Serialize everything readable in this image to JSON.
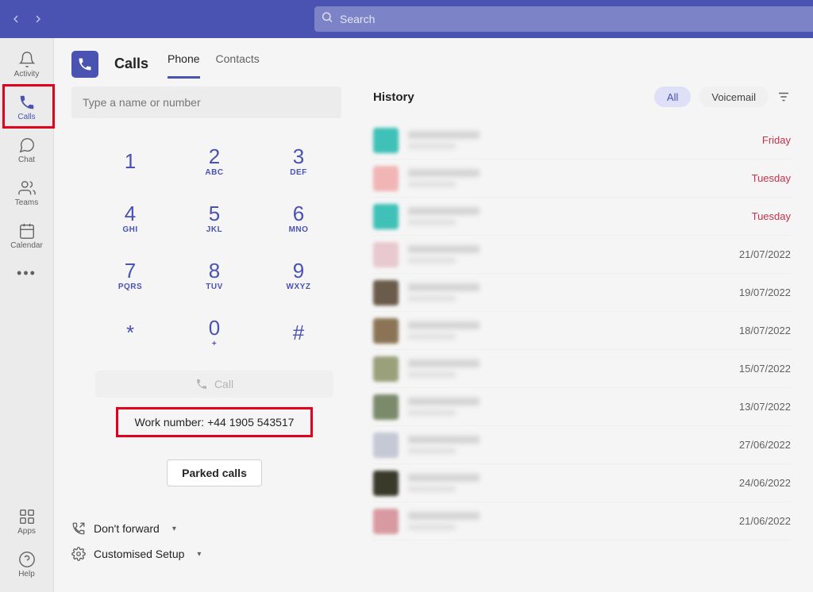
{
  "topbar": {
    "search_placeholder": "Search"
  },
  "rail": {
    "items": [
      {
        "label": "Activity"
      },
      {
        "label": "Calls"
      },
      {
        "label": "Chat"
      },
      {
        "label": "Teams"
      },
      {
        "label": "Calendar"
      }
    ],
    "bottom": [
      {
        "label": "Apps"
      },
      {
        "label": "Help"
      }
    ]
  },
  "header": {
    "title": "Calls",
    "tabs": [
      {
        "label": "Phone",
        "active": true
      },
      {
        "label": "Contacts",
        "active": false
      }
    ]
  },
  "dialer": {
    "input_placeholder": "Type a name or number",
    "keys": [
      {
        "digit": "1",
        "letters": ""
      },
      {
        "digit": "2",
        "letters": "ABC"
      },
      {
        "digit": "3",
        "letters": "DEF"
      },
      {
        "digit": "4",
        "letters": "GHI"
      },
      {
        "digit": "5",
        "letters": "JKL"
      },
      {
        "digit": "6",
        "letters": "MNO"
      },
      {
        "digit": "7",
        "letters": "PQRS"
      },
      {
        "digit": "8",
        "letters": "TUV"
      },
      {
        "digit": "9",
        "letters": "WXYZ"
      },
      {
        "digit": "*",
        "letters": ""
      },
      {
        "digit": "0",
        "letters": "+"
      },
      {
        "digit": "#",
        "letters": ""
      }
    ],
    "call_label": "Call",
    "work_number_label": "Work number: +44 1905 543517",
    "parked_label": "Parked calls",
    "forward_label": "Don't forward",
    "setup_label": "Customised Setup"
  },
  "history": {
    "title": "History",
    "filters": {
      "all": "All",
      "voicemail": "Voicemail"
    },
    "items": [
      {
        "date": "Friday",
        "missed": true,
        "avatar_color": "#3fc1b8"
      },
      {
        "date": "Tuesday",
        "missed": true,
        "avatar_color": "#f2b5b5"
      },
      {
        "date": "Tuesday",
        "missed": true,
        "avatar_color": "#3fc1b8"
      },
      {
        "date": "21/07/2022",
        "missed": false,
        "avatar_color": "#e8c9d0"
      },
      {
        "date": "19/07/2022",
        "missed": false,
        "avatar_color": "#6b5b4a"
      },
      {
        "date": "18/07/2022",
        "missed": false,
        "avatar_color": "#8a7455"
      },
      {
        "date": "15/07/2022",
        "missed": false,
        "avatar_color": "#9aa07a"
      },
      {
        "date": "13/07/2022",
        "missed": false,
        "avatar_color": "#7a8a6a"
      },
      {
        "date": "27/06/2022",
        "missed": false,
        "avatar_color": "#c5c9d6"
      },
      {
        "date": "24/06/2022",
        "missed": false,
        "avatar_color": "#3a3a2a"
      },
      {
        "date": "21/06/2022",
        "missed": false,
        "avatar_color": "#d89aa0"
      }
    ]
  }
}
